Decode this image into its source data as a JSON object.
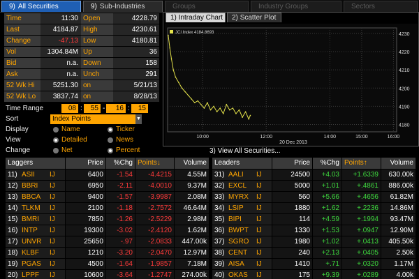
{
  "tabs": [
    {
      "num": "9)",
      "label": "All Securities",
      "state": "active"
    },
    {
      "num": "9)",
      "label": "Sub-Industries",
      "state": "normal"
    },
    {
      "num": "",
      "label": "Groups",
      "state": "dim"
    },
    {
      "num": "",
      "label": "Industry Groups",
      "state": "dim"
    },
    {
      "num": "",
      "label": "Sectors",
      "state": "dim"
    }
  ],
  "stats": [
    {
      "k1": "Time",
      "v1": "11:30",
      "k2": "Open",
      "v2": "4228.79",
      "v1_color": ""
    },
    {
      "k1": "Last",
      "v1": "4184.87",
      "k2": "High",
      "v2": "4230.61",
      "v1_color": ""
    },
    {
      "k1": "Change",
      "v1": "-47.13",
      "k2": "Low",
      "v2": "4180.81",
      "v1_color": "red"
    },
    {
      "k1": "Vol",
      "v1": "1304.84M",
      "k2": "Up",
      "v2": "36",
      "v1_color": ""
    },
    {
      "k1": "Bid",
      "v1": "n.a.",
      "k2": "Down",
      "v2": "158",
      "v1_color": ""
    },
    {
      "k1": "Ask",
      "v1": "n.a.",
      "k2": "Unch",
      "v2": "291",
      "v1_color": ""
    },
    {
      "k1": "52 Wk Hi",
      "v1": "5251.30",
      "k2": "on",
      "v2": "5/21/13",
      "v1_color": ""
    },
    {
      "k1": "52 Wk Lo",
      "v1": "3837.74",
      "k2": "on",
      "v2": "8/28/13",
      "v1_color": ""
    }
  ],
  "controls": {
    "time_range_label": "Time Range",
    "time_values": [
      "08",
      "55",
      "16",
      "15"
    ],
    "sort_label": "Sort",
    "sort_value": "Index Points",
    "display_label": "Display",
    "display_options": [
      "Name",
      "Ticker"
    ],
    "view_label": "View",
    "view_options": [
      "Detailed",
      "News"
    ],
    "change_label": "Change",
    "change_options": [
      "Net",
      "Percent"
    ]
  },
  "chart_tabs": [
    {
      "num": "1)",
      "label": "Intraday Chart",
      "state": "active"
    },
    {
      "num": "2)",
      "label": "Scatter Plot",
      "state": "inactive"
    }
  ],
  "chart_data": {
    "type": "line",
    "legend": "JCI Index 4184.8693",
    "date_label": "20 Dec 2013",
    "x_ticks": [
      "10:00",
      "12:00",
      "14:00",
      "15:00",
      "16:00"
    ],
    "x_tick_hours": [
      10,
      12,
      14,
      15,
      16
    ],
    "y_ticks": [
      "4230",
      "4220",
      "4210",
      "4200",
      "4190",
      "4180"
    ],
    "y_tick_values": [
      4230,
      4220,
      4210,
      4200,
      4190,
      4180
    ],
    "ylim": [
      4176,
      4233
    ],
    "xlim": [
      8.9,
      16.1
    ],
    "x": [
      8.92,
      8.97,
      9.02,
      9.08,
      9.15,
      9.25,
      9.35,
      9.45,
      9.55,
      9.65,
      9.75,
      9.85,
      9.95,
      10.05,
      10.15,
      10.25,
      10.35,
      10.45,
      10.55,
      10.65,
      10.75,
      10.85,
      10.95,
      11.05,
      11.15,
      11.25,
      11.35,
      11.45,
      11.5
    ],
    "y": [
      4229,
      4222,
      4216,
      4210,
      4206,
      4203,
      4200,
      4198,
      4196,
      4194,
      4192,
      4193,
      4191,
      4189,
      4192,
      4188,
      4190,
      4187,
      4189,
      4186,
      4191,
      4188,
      4189,
      4186,
      4188,
      4184,
      4187,
      4183,
      4185
    ],
    "line_color": "#e4e24a"
  },
  "view_all_label": "3) View All Securities...",
  "laggers": {
    "headers": [
      "Laggers",
      "Price",
      "%Chg",
      "Points↓",
      "Volume"
    ],
    "rows": [
      {
        "idx": "11)",
        "name": "ASII",
        "ex": "IJ",
        "price": "6400",
        "chg": "-1.54",
        "pts": "-4.4215",
        "vol": "4.55M"
      },
      {
        "idx": "12)",
        "name": "BBRI",
        "ex": "IJ",
        "price": "6950",
        "chg": "-2.11",
        "pts": "-4.0010",
        "vol": "9.37M"
      },
      {
        "idx": "13)",
        "name": "BBCA",
        "ex": "IJ",
        "price": "9400",
        "chg": "-1.57",
        "pts": "-3.9987",
        "vol": "2.08M"
      },
      {
        "idx": "14)",
        "name": "TLKM",
        "ex": "IJ",
        "price": "2100",
        "chg": "-1.18",
        "pts": "-2.7572",
        "vol": "46.64M"
      },
      {
        "idx": "15)",
        "name": "BMRI",
        "ex": "IJ",
        "price": "7850",
        "chg": "-1.26",
        "pts": "-2.5229",
        "vol": "2.98M"
      },
      {
        "idx": "16)",
        "name": "INTP",
        "ex": "IJ",
        "price": "19300",
        "chg": "-3.02",
        "pts": "-2.4120",
        "vol": "1.62M"
      },
      {
        "idx": "17)",
        "name": "UNVR",
        "ex": "IJ",
        "price": "25650",
        "chg": "-.97",
        "pts": "-2.0833",
        "vol": "447.00k"
      },
      {
        "idx": "18)",
        "name": "KLBF",
        "ex": "IJ",
        "price": "1210",
        "chg": "-3.20",
        "pts": "-2.0470",
        "vol": "12.97M"
      },
      {
        "idx": "19)",
        "name": "PGAS",
        "ex": "IJ",
        "price": "4500",
        "chg": "-1.64",
        "pts": "-1.9857",
        "vol": "7.18M"
      },
      {
        "idx": "20)",
        "name": "LPPF",
        "ex": "IJ",
        "price": "10600",
        "chg": "-3.64",
        "pts": "-1.2747",
        "vol": "274.00k"
      }
    ]
  },
  "leaders": {
    "headers": [
      "Leaders",
      "Price",
      "%Chg",
      "Points↑",
      "Volume"
    ],
    "rows": [
      {
        "idx": "31)",
        "name": "AALI",
        "ex": "IJ",
        "price": "24500",
        "chg": "+4.03",
        "pts": "+1.6339",
        "vol": "630.00k"
      },
      {
        "idx": "32)",
        "name": "EXCL",
        "ex": "IJ",
        "price": "5000",
        "chg": "+1.01",
        "pts": "+.4861",
        "vol": "886.00k"
      },
      {
        "idx": "33)",
        "name": "MYRX",
        "ex": "IJ",
        "price": "560",
        "chg": "+5.66",
        "pts": "+.4656",
        "vol": "61.82M"
      },
      {
        "idx": "34)",
        "name": "LSIP",
        "ex": "IJ",
        "price": "1880",
        "chg": "+1.62",
        "pts": "+.2236",
        "vol": "14.86M"
      },
      {
        "idx": "35)",
        "name": "BIPI",
        "ex": "IJ",
        "price": "114",
        "chg": "+4.59",
        "pts": "+.1994",
        "vol": "93.47M"
      },
      {
        "idx": "36)",
        "name": "BWPT",
        "ex": "IJ",
        "price": "1330",
        "chg": "+1.53",
        "pts": "+.0947",
        "vol": "12.90M"
      },
      {
        "idx": "37)",
        "name": "SGRO",
        "ex": "IJ",
        "price": "1980",
        "chg": "+1.02",
        "pts": "+.0413",
        "vol": "405.50k"
      },
      {
        "idx": "38)",
        "name": "CENT",
        "ex": "IJ",
        "price": "240",
        "chg": "+2.13",
        "pts": "+.0405",
        "vol": "2.50k"
      },
      {
        "idx": "39)",
        "name": "AISA",
        "ex": "IJ",
        "price": "1410",
        "chg": "+.71",
        "pts": "+.0320",
        "vol": "1.17M"
      },
      {
        "idx": "40)",
        "name": "OKAS",
        "ex": "IJ",
        "price": "175",
        "chg": "+9.39",
        "pts": "+.0289",
        "vol": "4.00k"
      }
    ]
  }
}
